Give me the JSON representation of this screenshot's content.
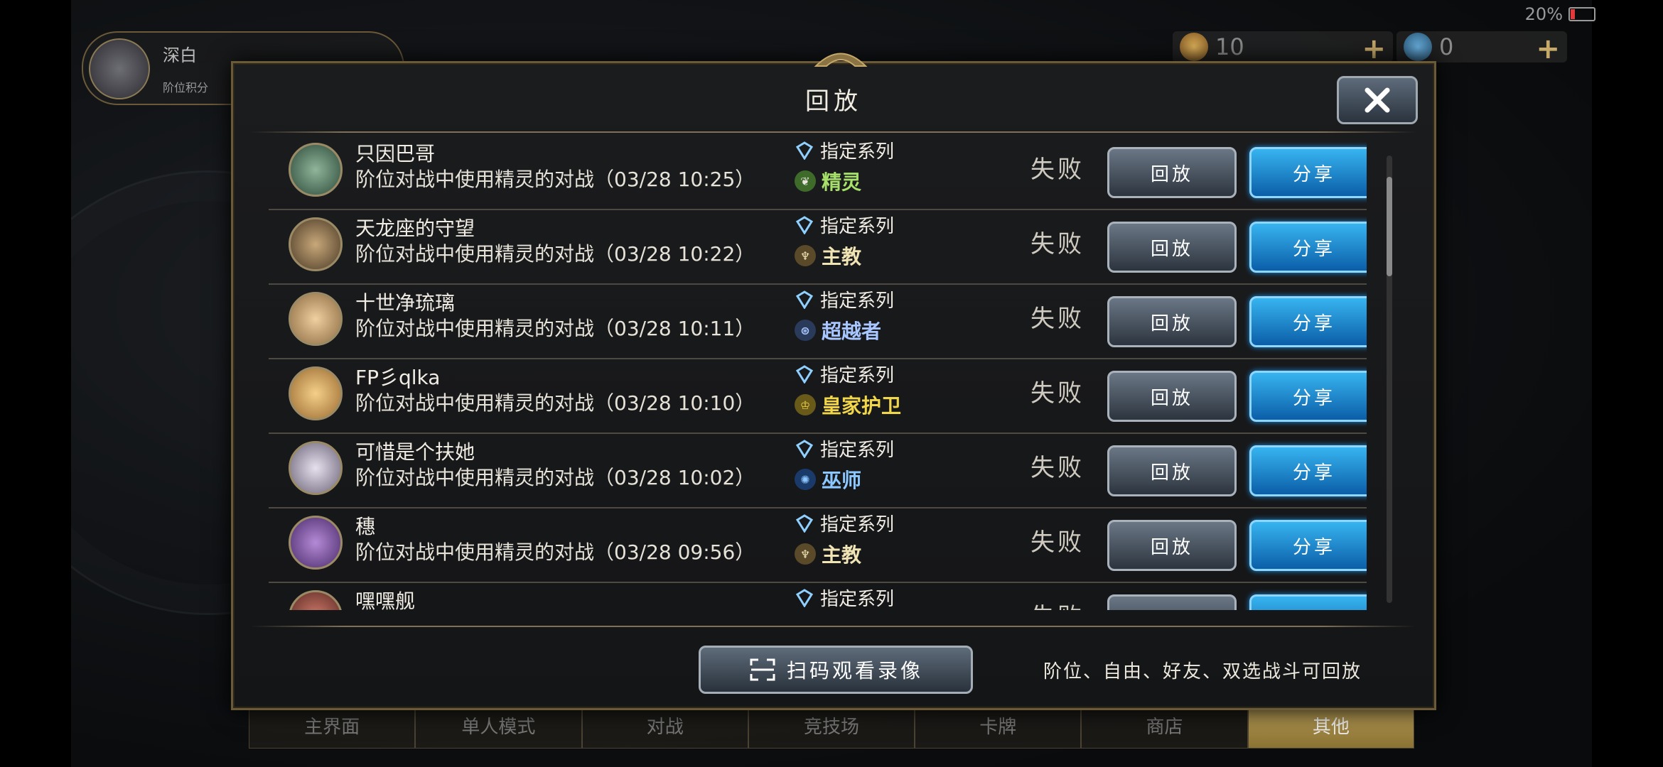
{
  "status": {
    "battery_text": "20",
    "battery_unit": "%"
  },
  "background": {
    "profile_name": "深白",
    "profile_sub": "阶位积分",
    "currencies": [
      "10",
      "0"
    ],
    "nav": [
      "主界面",
      "单人模式",
      "对战",
      "竞技场",
      "卡牌",
      "商店",
      "其他"
    ]
  },
  "dialog": {
    "title": "回放",
    "replay_label": "回放",
    "share_label": "分享",
    "scan_button": "扫码观看录像",
    "hint": "阶位、自由、好友、双选战斗可回放"
  },
  "rows": [
    {
      "name": "只因巴哥",
      "desc": "阶位对战中使用精灵的对战（03/28 10:25）",
      "mode": "指定系列",
      "class": "精灵",
      "class_color": "#a6e06a",
      "class_icon": "leaf-icon",
      "result": "失败"
    },
    {
      "name": "天龙座的守望",
      "desc": "阶位对战中使用精灵的对战（03/28 10:22）",
      "mode": "指定系列",
      "class": "主教",
      "class_color": "#f0e3b4",
      "class_icon": "bishop-icon",
      "result": "失败"
    },
    {
      "name": "十世净琉璃",
      "desc": "阶位对战中使用精灵的对战（03/28 10:11）",
      "mode": "指定系列",
      "class": "超越者",
      "class_color": "#a8c6ff",
      "class_icon": "portal-icon",
      "result": "失败"
    },
    {
      "name": "FP彡qlka",
      "desc": "阶位对战中使用精灵的对战（03/28 10:10）",
      "mode": "指定系列",
      "class": "皇家护卫",
      "class_color": "#f2d64a",
      "class_icon": "crown-icon",
      "result": "失败"
    },
    {
      "name": "可惜是个扶她",
      "desc": "阶位对战中使用精灵的对战（03/28 10:02）",
      "mode": "指定系列",
      "class": "巫师",
      "class_color": "#8cc8ff",
      "class_icon": "rune-icon",
      "result": "失败"
    },
    {
      "name": "穗",
      "desc": "阶位对战中使用精灵的对战（03/28 09:56）",
      "mode": "指定系列",
      "class": "主教",
      "class_color": "#f0e3b4",
      "class_icon": "bishop-icon",
      "result": "失败"
    },
    {
      "name": "嘿嘿舰",
      "desc": "",
      "mode": "指定系列",
      "class": "",
      "class_color": "#f0e3b4",
      "class_icon": "",
      "result": "失败"
    }
  ]
}
